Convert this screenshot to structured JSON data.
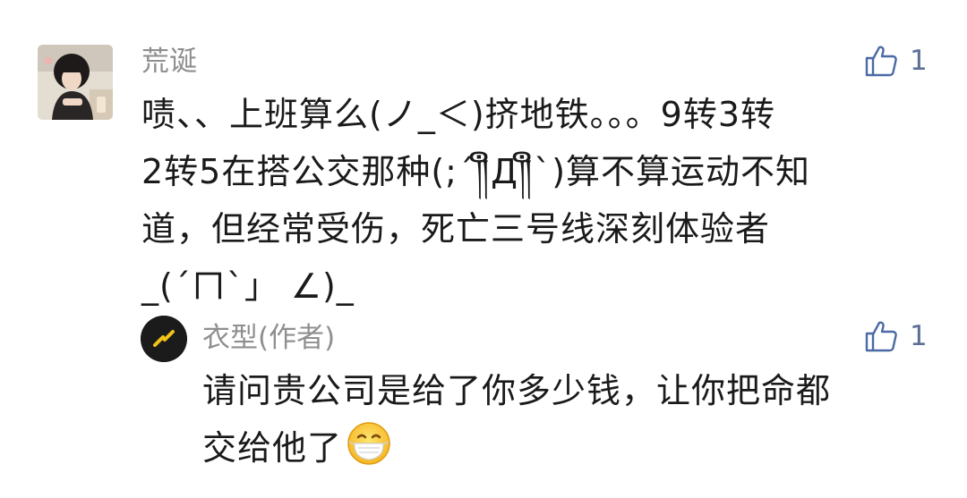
{
  "comment": {
    "author": "荒诞",
    "likes": "1",
    "lines": [
      "啧、、上班算么(ノ_＜)挤地铁。。。9转3转",
      "2转5在搭公交那种(;´༎ຶД༎ຶ`)算不算运动不知",
      "道，但经常受伤，死亡三号线深刻体验者",
      "_(´ㄇ`」 ∠)_"
    ]
  },
  "reply": {
    "author": "衣型(作者)",
    "likes": "1",
    "lines": [
      "请问贵公司是给了你多少钱，让你把命都",
      "交给他了"
    ],
    "emoji": "mask-face-emoji"
  },
  "icons": {
    "like": "thumbs-up-icon",
    "avatar_main": "user-photo",
    "avatar_reply": "author-logo"
  },
  "colors": {
    "name": "#8f8f8f",
    "text": "#1a1a1a",
    "like": "#4a6aa5"
  }
}
